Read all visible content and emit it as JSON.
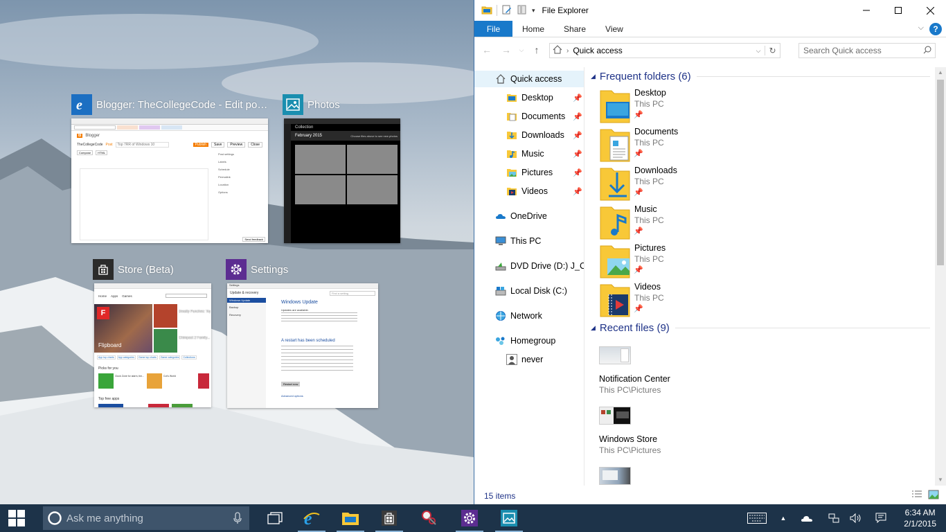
{
  "task_view": [
    {
      "title": "Blogger: TheCollegeCode - Edit post...",
      "icon": "ie-icon"
    },
    {
      "title": "Photos",
      "icon": "photos-icon"
    },
    {
      "title": "Store (Beta)",
      "icon": "store-icon"
    },
    {
      "title": "Settings",
      "icon": "settings-icon"
    }
  ],
  "thumbs": {
    "blogger": {
      "brand": "Blogger",
      "blog": "TheCollegeCode",
      "post": "Post",
      "post_title": "Top 7RR of Windows 10",
      "side": [
        "Post settings",
        "Labels",
        "Schedule",
        "Permalink",
        "Location",
        "Options"
      ],
      "btn_publish": "Publish",
      "btn_save": "Save",
      "btn_preview": "Preview",
      "btn_close": "Close",
      "compose": "Compose",
      "html": "HTML",
      "send": "Send feedback"
    },
    "photos": {
      "header": "Collection",
      "month": "February 2015",
      "hint": "Choose files above to see new photos"
    },
    "store": {
      "tabs": [
        "Home",
        "Apps",
        "Games"
      ],
      "hero": "Flipboard",
      "tile1": "Deadly Punches: Toy...",
      "tile2": "Chimpact 2 Family...",
      "links": [
        "App top charts",
        "App categories",
        "Game top charts",
        "Game categories",
        "Collections"
      ],
      "picks": "Picks for you",
      "top": "Top free apps",
      "app1": "Clock Zone for alarm, tim...",
      "app2": "Cut's World"
    },
    "settings": {
      "window": "Settings",
      "section": "Update & recovery",
      "search": "Find a setting",
      "nav": [
        "Windows Update",
        "Backup",
        "Recovery"
      ],
      "heading": "Windows Update",
      "text1": "Updates are available.",
      "heading2": "A restart has been scheduled",
      "btn": "Restart now",
      "link": "Advanced options"
    }
  },
  "explorer": {
    "title": "File Explorer",
    "tabs": [
      "File",
      "Home",
      "Share",
      "View"
    ],
    "address_path": "Quick access",
    "search_placeholder": "Search Quick access",
    "nav": [
      {
        "label": "Quick access",
        "icon": "star-icon"
      },
      {
        "label": "Desktop",
        "icon": "desktop-folder-icon",
        "pinned": true
      },
      {
        "label": "Documents",
        "icon": "documents-folder-icon",
        "pinned": true
      },
      {
        "label": "Downloads",
        "icon": "downloads-folder-icon",
        "pinned": true
      },
      {
        "label": "Music",
        "icon": "music-folder-icon",
        "pinned": true
      },
      {
        "label": "Pictures",
        "icon": "pictures-folder-icon",
        "pinned": true
      },
      {
        "label": "Videos",
        "icon": "videos-folder-icon",
        "pinned": true
      },
      {
        "label": "OneDrive",
        "icon": "onedrive-icon"
      },
      {
        "label": "This PC",
        "icon": "pc-icon"
      },
      {
        "label": "DVD Drive (D:) J_CCSA",
        "icon": "dvd-icon"
      },
      {
        "label": "Local Disk (C:)",
        "icon": "disk-icon"
      },
      {
        "label": "Network",
        "icon": "network-icon"
      },
      {
        "label": "Homegroup",
        "icon": "homegroup-icon"
      },
      {
        "label": "never",
        "icon": "user-icon"
      }
    ],
    "frequent_header": "Frequent folders (6)",
    "frequent": [
      {
        "name": "Desktop",
        "loc": "This PC"
      },
      {
        "name": "Documents",
        "loc": "This PC"
      },
      {
        "name": "Downloads",
        "loc": "This PC"
      },
      {
        "name": "Music",
        "loc": "This PC"
      },
      {
        "name": "Pictures",
        "loc": "This PC"
      },
      {
        "name": "Videos",
        "loc": "This PC"
      }
    ],
    "recent_header": "Recent files (9)",
    "recent": [
      {
        "name": "Notification Center",
        "loc": "This PC\\Pictures"
      },
      {
        "name": "Windows Store",
        "loc": "This PC\\Pictures"
      },
      {
        "name": "",
        "loc": ""
      }
    ],
    "status": "15 items"
  },
  "taskbar": {
    "search_placeholder": "Ask me anything",
    "time": "6:34 AM",
    "date": "2/1/2015"
  },
  "colors": {
    "accent": "#1979ca",
    "taskbar": "#1d3349",
    "header_text": "#1e3287",
    "folder": "#f8c838"
  }
}
